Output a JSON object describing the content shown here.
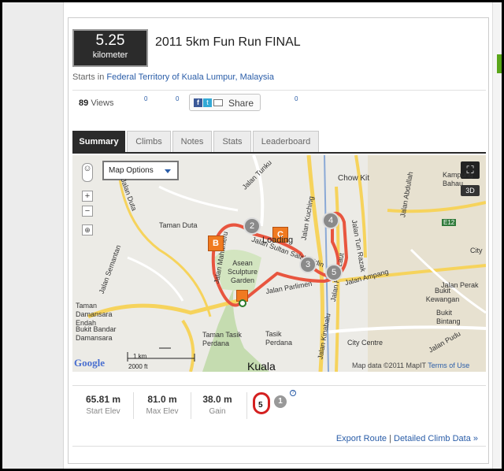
{
  "route": {
    "distance_value": "5.25",
    "distance_unit": "kilometer",
    "title": "2011 5km Fun Run FINAL",
    "starts_prefix": "Starts in",
    "location": "Federal Territory of Kuala Lumpur, Malaysia"
  },
  "social": {
    "views_count": "89",
    "views_label": "Views",
    "counter_1": "0",
    "counter_2": "0",
    "counter_3": "0",
    "share_label": "Share"
  },
  "tabs": [
    {
      "label": "Summary",
      "active": true
    },
    {
      "label": "Climbs",
      "active": false
    },
    {
      "label": "Notes",
      "active": false
    },
    {
      "label": "Stats",
      "active": false
    },
    {
      "label": "Leaderboard",
      "active": false
    }
  ],
  "map": {
    "options_label": "Map Options",
    "btn_3d": "3D",
    "loading_text": "Loading",
    "attribution_prefix": "Map data ©2011 MapIT",
    "attribution_link": "Terms of Use",
    "google_label": "Google",
    "scale_km": "1 km",
    "scale_ft": "2000 ft",
    "markers": [
      "B",
      "2",
      "C",
      "3",
      "4",
      "5"
    ],
    "labels": {
      "jalan_semantan": "Jalan Semantan",
      "taman_duta": "Taman Duta",
      "taman_damansara": "Taman Damansara Endah",
      "bukit_damansara": "Bukit Bandar Damansara",
      "jalan_tunku": "Jalan Tunku",
      "jalan_mahameru": "Jalan Mahameru",
      "jalan_sultan_salahuddin": "Jalan Sultan Salahuddin",
      "asean_sculpture": "Asean Sculpture Garden",
      "jalan_parlimen": "Jalan Parlimen",
      "taman_tasik_perdana": "Taman Tasik Perdana",
      "tasik_perdana": "Tasik Perdana",
      "kuala": "Kuala",
      "chow_kit": "Chow Kit",
      "kampung_baharu": "Kampung Bahau",
      "jalan_kuching": "Jalan Kuching",
      "jalan_raja_laut": "Jalan Raja Laut",
      "jalan_tun_razak": "Jalan Tun Razak",
      "e12": "E12",
      "jalan_ampang": "Jalan Ampang",
      "bukit_kewangan": "Bukit Kewangan",
      "bukit_bintang": "Bukit Bintang",
      "city_centre": "City Centre",
      "jalan_perak": "Jalan Perak",
      "jalan_pudu": "Jalan Pudu",
      "jalan_kinabalu": "Jalan Kinabalu",
      "jalan_abdullah": "Jalan Abdullah",
      "jalan_duta": "Jalan Duta",
      "city": "City"
    }
  },
  "stats": {
    "start_elev_value": "65.81 m",
    "start_elev_label": "Start Elev",
    "max_elev_value": "81.0 m",
    "max_elev_label": "Max Elev",
    "gain_value": "38.0 m",
    "gain_label": "Gain",
    "climb_category": "5",
    "climb_count": "1",
    "help_mark": "?"
  },
  "footer": {
    "export_route": "Export Route",
    "separator": "|",
    "detailed_climb": "Detailed Climb Data »"
  },
  "colors": {
    "route_line": "#e8553f",
    "tab_active_bg": "#2b2b2b",
    "link": "#2a5da8",
    "marker_orange": "#f07a20",
    "marker_gray": "#8a8a8a"
  }
}
